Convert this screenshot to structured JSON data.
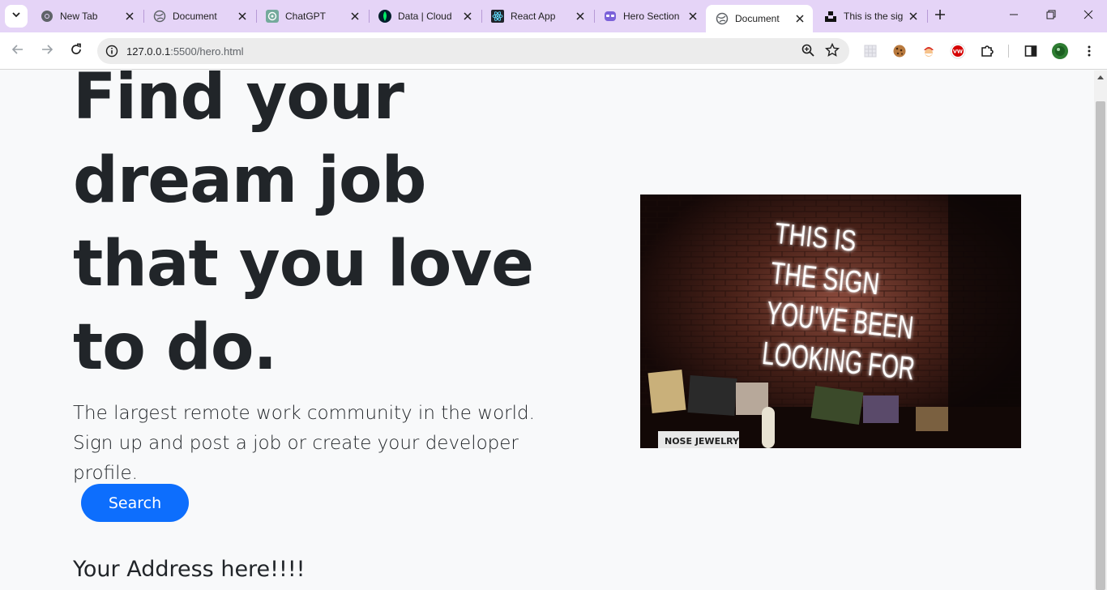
{
  "browser": {
    "tabs": [
      {
        "title": "New Tab",
        "icon": "chrome-icon"
      },
      {
        "title": "Document",
        "icon": "globe-icon"
      },
      {
        "title": "ChatGPT",
        "icon": "chatgpt-icon"
      },
      {
        "title": "Data | Cloud",
        "icon": "mongodb-leaf-icon"
      },
      {
        "title": "React App",
        "icon": "react-icon"
      },
      {
        "title": "Hero Section",
        "icon": "hero-mask-icon"
      },
      {
        "title": "Document",
        "icon": "globe-icon",
        "active": true
      },
      {
        "title": "This is the sign",
        "icon": "unsplash-icon"
      }
    ],
    "url_host": "127.0.0.1",
    "url_path": ":5500/hero.html",
    "colors": {
      "tabstrip": "#e5d4f7",
      "active_tab": "#ffffff",
      "omnibox": "#ececec"
    }
  },
  "hero": {
    "title": "Find your dream job that you love to do.",
    "lead": "The largest remote work community in the world. Sign up and post a job or create your developer profile.",
    "button_label": "Search",
    "address": "Your Address here!!!!",
    "button_color": "#0d6efd",
    "image": {
      "neon_lines": [
        "THIS IS",
        "THE SIGN",
        "YOU'VE BEEN",
        "LOOKING FOR"
      ],
      "shop_sign": "NOSE JEWELRY"
    }
  }
}
